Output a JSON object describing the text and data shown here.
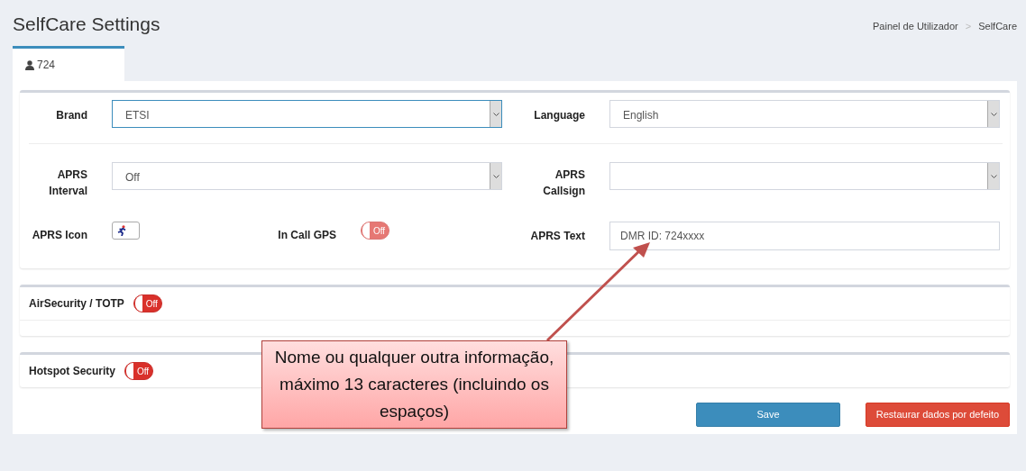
{
  "page": {
    "title": "SelfCare Settings",
    "breadcrumb": [
      {
        "label": "Painel de Utilizador"
      },
      {
        "label": "SelfCare"
      }
    ],
    "breadcrumb_separator": ">"
  },
  "tabs": [
    {
      "label": "724",
      "selected": true
    }
  ],
  "general": {
    "rows": [
      {
        "fields": [
          {
            "kind": "select",
            "label": "Brand",
            "value": "ETSI",
            "focused": true
          },
          {
            "kind": "select",
            "label": "Language",
            "value": "English",
            "focused": false
          }
        ]
      },
      {
        "fields": [
          {
            "kind": "select",
            "label": "APRS Interval",
            "value": "Off",
            "focused": false
          },
          {
            "kind": "select",
            "label": "APRS Callsign",
            "focused": false
          }
        ]
      },
      {
        "fields": [
          {
            "kind": "icon",
            "label": "APRS Icon"
          },
          {
            "kind": "toggle",
            "label": "In Call GPS",
            "on": false,
            "state_label": "Off",
            "disabled": true
          },
          {
            "kind": "text",
            "label": "APRS Text",
            "value": "DMR ID: 724xxxx"
          }
        ]
      }
    ]
  },
  "sections": [
    {
      "label": "AirSecurity / TOTP",
      "on": false,
      "state_label": "Off",
      "footer_line": true
    },
    {
      "label": "Hotspot Security",
      "on": false,
      "state_label": "Off",
      "footer_line": false
    }
  ],
  "buttons": [
    {
      "label": "Save",
      "kind": "primary"
    },
    {
      "label": "Restaurar dados por defeito",
      "kind": "danger"
    }
  ],
  "callout": {
    "text": "Nome ou qualquer outra informação, máximo 13 caracteres (incluindo os espaços)"
  }
}
